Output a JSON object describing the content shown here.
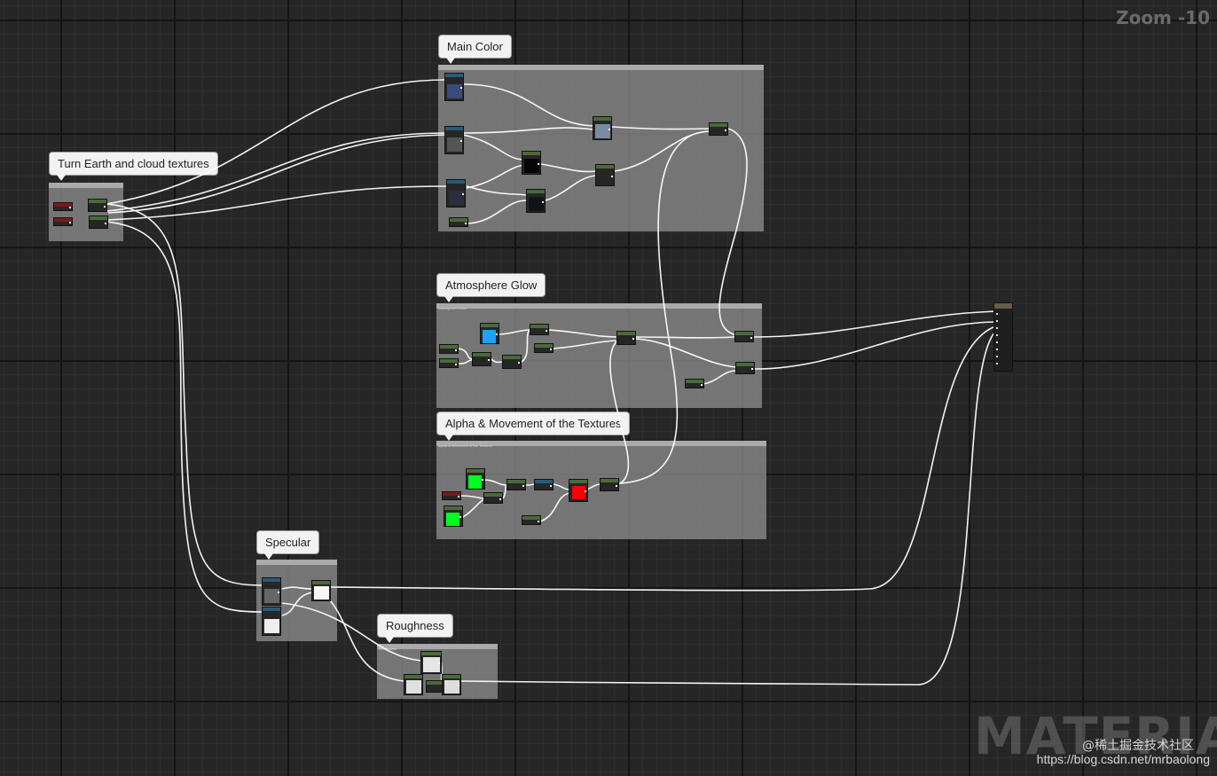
{
  "zoom_label": "Zoom -10",
  "comments": {
    "turn": "Turn Earth and cloud textures",
    "main_color": "Main Color",
    "atmosphere": "Atmosphere Glow",
    "alpha": "Alpha & Movement of the Textures",
    "specular": "Specular",
    "roughness": "Roughness"
  },
  "watermark_text": "MATERIAL",
  "attribution": {
    "line1": "@稀土掘金技术社区",
    "line2": "https://blog.csdn.net/mrbaolong"
  },
  "colors": {
    "canvas": "#262626",
    "comment_fill": "#8c8c8c",
    "wire": "#ffffff",
    "texture_header": "#2a5a7a",
    "math_header": "#4a6a3a",
    "param_header": "#7a1a1a",
    "color_blue": "#1ea0ff",
    "color_green": "#00ff1e",
    "color_red": "#ff0000"
  }
}
